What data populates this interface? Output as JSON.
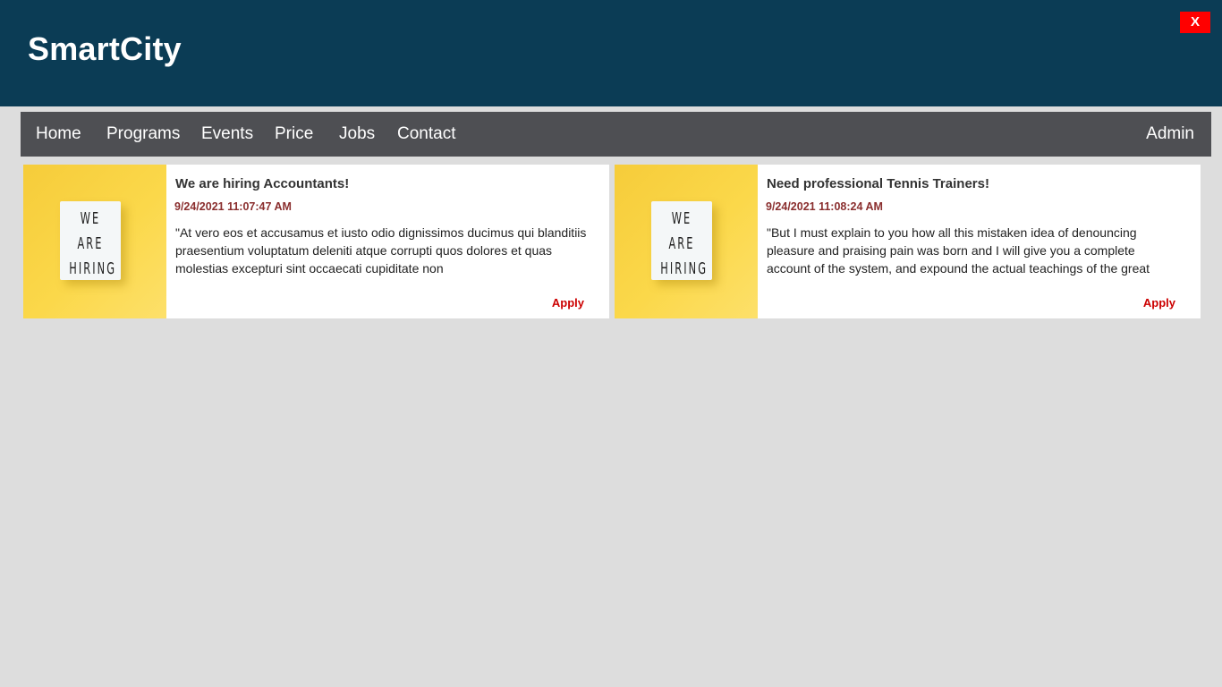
{
  "header": {
    "brand": "SmartCity",
    "close_label": "X"
  },
  "nav": {
    "items": [
      "Home",
      "Programs",
      "Events",
      "Price",
      "Jobs",
      "Contact"
    ],
    "admin": "Admin"
  },
  "jobs": [
    {
      "title": "We are hiring Accountants!",
      "date": "9/24/2021 11:07:47 AM",
      "description": "\"At vero eos et accusamus et iusto odio dignissimos ducimus qui blanditiis praesentium voluptatum deleniti atque corrupti quos dolores et quas molestias excepturi sint occaecati cupiditate non",
      "image_text": "WE ARE HIRING",
      "apply_label": "Apply"
    },
    {
      "title": "Need professional Tennis Trainers!",
      "date": "9/24/2021 11:08:24 AM",
      "description": "\"But I must explain to you how all this mistaken idea of denouncing pleasure and praising pain was born and I will give you a complete account of the system, and expound the actual teachings of the great",
      "image_text": "WE ARE HIRING",
      "apply_label": "Apply"
    }
  ],
  "colors": {
    "header_bg": "#0b3c55",
    "nav_bg": "#4e4f53",
    "page_bg": "#dddddd",
    "date_color": "#8a2e2e",
    "apply_color": "#cc0000",
    "close_bg": "#ff0000"
  }
}
